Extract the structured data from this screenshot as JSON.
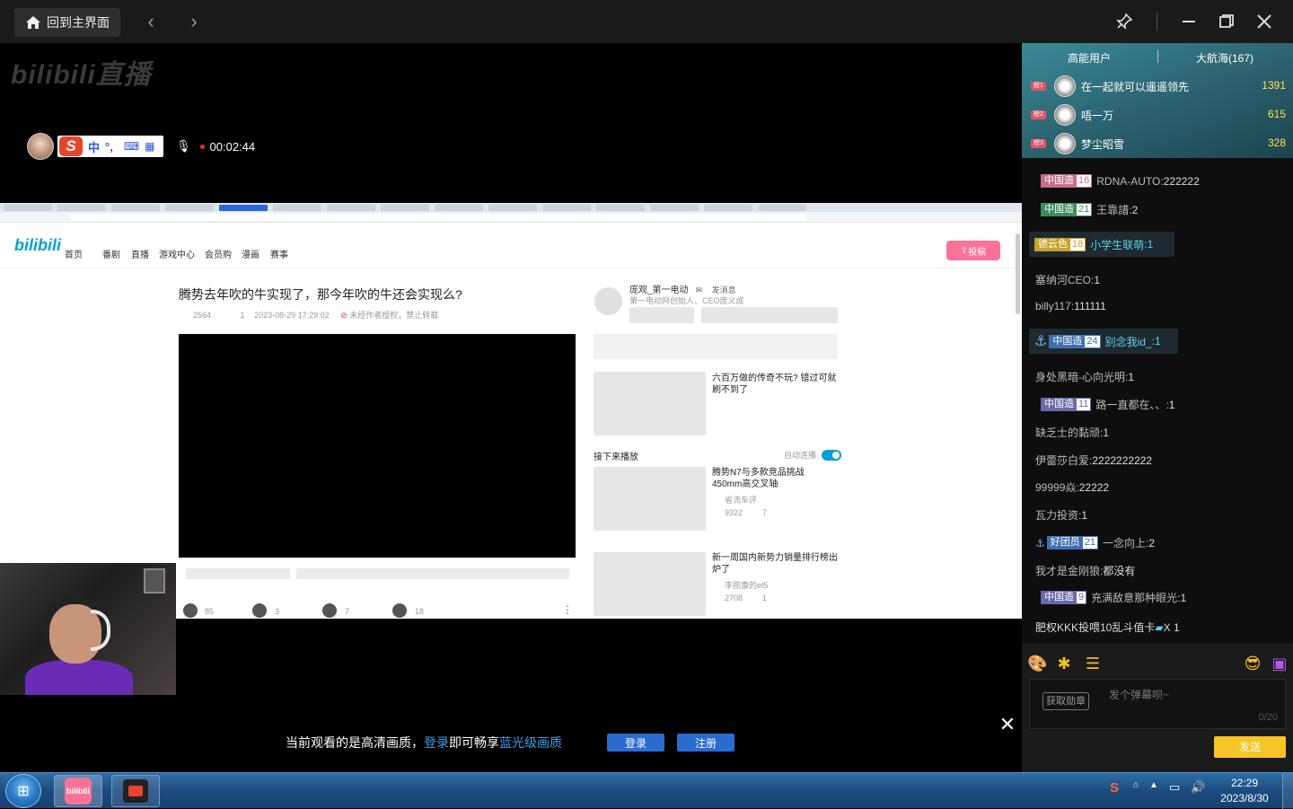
{
  "topbar": {
    "home_label": "回到主界面",
    "back_icon": "chevron-left-icon",
    "forward_icon": "chevron-right-icon"
  },
  "player": {
    "logo_text": "bilibili直播",
    "stream_timer": "00:02:44",
    "ime": {
      "logo": "S",
      "lang": "中",
      "punct": "°,"
    },
    "webpage": {
      "nav": [
        "首页",
        "番剧",
        "直播",
        "游戏中心",
        "会员购",
        "漫画",
        "赛事"
      ],
      "upload_label": "投稿",
      "video_title": "腾势去年吹的牛实现了，那今年吹的牛还会实现么?",
      "views": "2564",
      "danmaku": "1",
      "date": "2023-08-29 17:29:02",
      "notice": "未经作者授权，禁止转载",
      "likes": "85",
      "coins": "3",
      "favs": "7",
      "shares": "18",
      "up_name": "庞观_第一电动",
      "up_msg": "发消息",
      "up_desc": "第一电动网创始人、CEO庞义成",
      "next_label": "接下来播放",
      "autoplay_label": "自动连播",
      "cards": [
        {
          "title": "六百万做的传奇不玩? 错过可就刷不到了",
          "author": "",
          "views": "",
          "dm": ""
        },
        {
          "title": "腾势N7与多款竞品挑战450mm高交叉轴",
          "author": "省流车评",
          "views": "9322",
          "dm": "7"
        },
        {
          "title": "新一周国内新势力销量排行榜出炉了",
          "author": "李揽康的et5",
          "views": "2708",
          "dm": "1"
        }
      ]
    },
    "quality_banner": {
      "text1": "当前观看的是高清画质，",
      "login_link": "登录",
      "text2": "即可畅享",
      "quality_link": "蓝光级画质",
      "login_btn": "登录",
      "register_btn": "注册"
    }
  },
  "sidebar": {
    "tabs": [
      "高能用户",
      "大航海(167)"
    ],
    "top_users": [
      {
        "rank": "榜1",
        "name": "在一起就可以遥遥领先",
        "score": "1391"
      },
      {
        "rank": "榜2",
        "name": "唔一万",
        "score": "615"
      },
      {
        "rank": "榜3",
        "name": "梦尘昭雪",
        "score": "328"
      }
    ],
    "chat": [
      {
        "medal": "中国造",
        "level": "16",
        "user": "RDNA-AUTO",
        "text": "222222"
      },
      {
        "medal": "中国造",
        "level": "21",
        "user": "王靠譜",
        "text": "2"
      },
      {
        "medal": "德云色",
        "level": "18",
        "user": "小学生联萌",
        "text": "1"
      },
      {
        "medal": "",
        "level": "",
        "user": "塞纳河CEO",
        "text": "1"
      },
      {
        "medal": "",
        "level": "",
        "user": "billy117",
        "text": "111111"
      },
      {
        "medal": "中国造",
        "level": "24",
        "user": "别念我id_",
        "text": "1"
      },
      {
        "medal": "",
        "level": "",
        "user": "身处黑暗-心向光明",
        "text": "1"
      },
      {
        "medal": "中国造",
        "level": "11",
        "user": "路一直都在、、",
        "text": "1"
      },
      {
        "medal": "",
        "level": "",
        "user": "缺乏士的黏顽",
        "text": "1"
      },
      {
        "medal": "",
        "level": "",
        "user": "伊蕾莎白爱",
        "text": "2222222222"
      },
      {
        "medal": "",
        "level": "",
        "user": "99999焱",
        "text": "22222"
      },
      {
        "medal": "",
        "level": "",
        "user": "瓦力投资",
        "text": "1"
      },
      {
        "medal": "好团员",
        "level": "21",
        "user": "一念向上",
        "text": "2"
      },
      {
        "medal": "",
        "level": "",
        "user": "我才是金刚狼",
        "text": "都没有"
      },
      {
        "medal": "中国造",
        "level": "9",
        "user": "充满敌意那种眼光",
        "text": "1"
      },
      {
        "medal": "",
        "level": "",
        "user": "肥权KKK投喂10乱斗值卡",
        "text": "X 1"
      }
    ],
    "input": {
      "medal_btn": "获取勋章",
      "placeholder": "发个弹幕呗~",
      "counter": "0/20",
      "send": "发送"
    }
  },
  "taskbar": {
    "time": "22:29",
    "date": "2023/8/30",
    "app1": "bilibili"
  },
  "colors": {
    "accent_pink": "#fb7299",
    "bili_blue": "#00a1d6",
    "gold": "#f7c525"
  }
}
